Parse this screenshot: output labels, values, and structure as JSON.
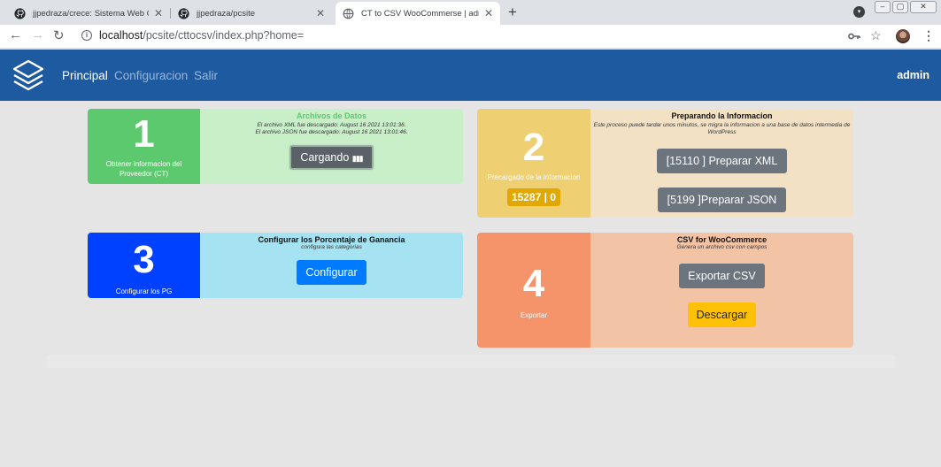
{
  "browser": {
    "tabs": [
      {
        "title": "jjpedraza/crece: Sistema Web Crece",
        "icon": "github-icon",
        "close": "✕"
      },
      {
        "title": "jjpedraza/pcsite",
        "icon": "github-icon",
        "close": "✕"
      },
      {
        "title": "CT to CSV WooCommerse | admin |",
        "icon": "globe-icon",
        "close": "✕",
        "active": true
      }
    ],
    "new_tab": "+",
    "url_host": "localhost",
    "url_path": "/pcsite/cttocsv/index.php?home="
  },
  "navbar": {
    "links": [
      "Principal",
      "Configuracion",
      "Salir"
    ],
    "user": "admin",
    "color": "#1e5aa0"
  },
  "cards": {
    "c1": {
      "number": "1",
      "caption": "Obtener informacion del Proveedor (CT)",
      "title": "Archivos de Datos",
      "line1": "El archivo XML fue descargado: August 16 2021 13:01:36.",
      "line2": "El archivo JSON fue descargado: August 16 2021 13:01:46.",
      "button": "Cargando",
      "colors": {
        "side": "#5cc96e",
        "body": "#c8efc8",
        "title": "#5cc96e"
      }
    },
    "c2": {
      "number": "2",
      "caption": "Precargado de la Informacion",
      "counter": "15287 | 0",
      "title": "Preparando la Informacion",
      "desc": "Este proceso puede tardar unos minutos, se migra la informacion a una base de datos intermedia de WordPress",
      "button_xml": "[15110 ] Preparar XML",
      "button_json": "[5199 ]Preparar JSON",
      "colors": {
        "side": "#eecf72",
        "body": "#f3e1c6"
      }
    },
    "c3": {
      "number": "3",
      "caption": "Configurar los PG",
      "title": "Configurar los Porcentaje de Ganancia",
      "desc": "configura las categorias",
      "button": "Configurar",
      "colors": {
        "side": "#0040ff",
        "body": "#a5e3f3"
      }
    },
    "c4": {
      "number": "4",
      "caption": "Exportar",
      "title": "CSV for WooCommerce",
      "desc": "Genera un archivo csv con campos",
      "button_export": "Exportar CSV",
      "button_download": "Descargar",
      "colors": {
        "side": "#f5946b",
        "body": "#f3c3a5"
      }
    }
  }
}
